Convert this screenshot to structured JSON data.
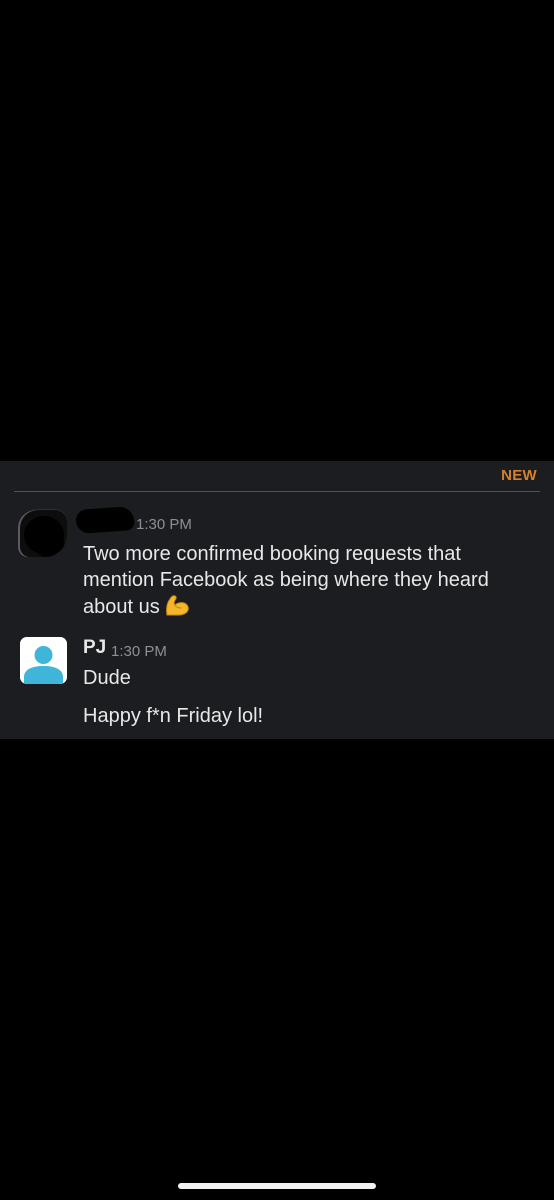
{
  "chat": {
    "new_divider_label": "NEW",
    "messages": [
      {
        "sender": "",
        "timestamp": "1:30 PM",
        "text": "Two more confirmed booking requests that mention Facebook as being where they heard about us",
        "emoji": "flexed-biceps"
      },
      {
        "sender": "PJ",
        "timestamp": "1:30 PM",
        "lines": [
          "Dude",
          "Happy f*n Friday lol!"
        ]
      }
    ]
  },
  "colors": {
    "background": "#000000",
    "panel": "#1c1d21",
    "new_accent": "#d3812b",
    "avatar_accent": "#3eb5d9"
  }
}
